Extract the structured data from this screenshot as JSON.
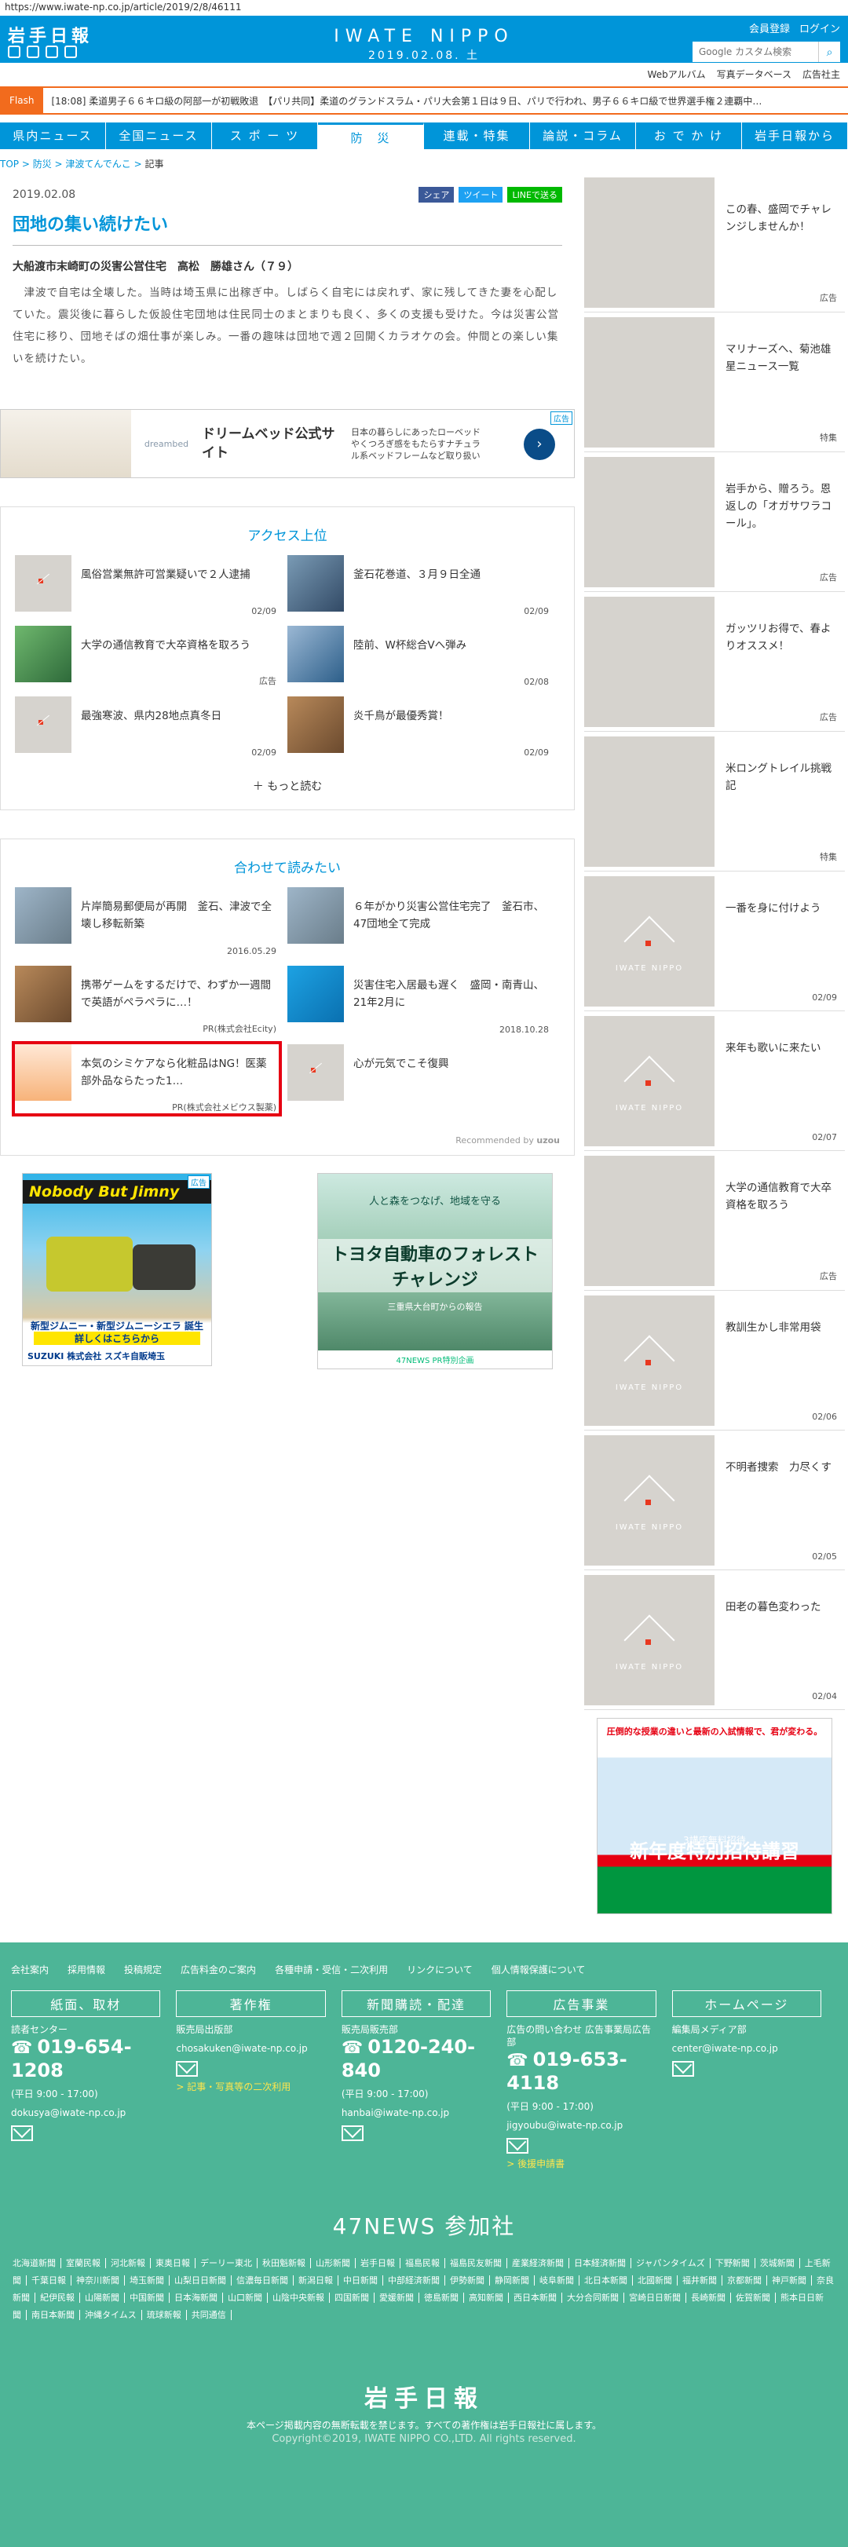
{
  "url": "https://www.iwate-np.co.jp/article/2019/2/8/46111",
  "header": {
    "logo": "岩手日報",
    "brand": "IWATE NIPPO",
    "date": "2019.02.08. 土",
    "member": "会員登録",
    "login": "ログイン",
    "search_placeholder": "Google カスタム検索",
    "sub": [
      "Webアルバム",
      "写真データベース",
      "広告社主"
    ]
  },
  "flash": {
    "label": "Flash",
    "text": "[18:08] 柔道男子６６キロ級の阿部一が初戦敗退　【パリ共同】柔道のグランドスラム・パリ大会第１日は９日、パリで行われ、男子６６キロ級で世界選手権２連覇中…"
  },
  "nav": [
    "県内ニュース",
    "全国ニュース",
    "ス ポ ー ツ",
    "防　災",
    "連載・特集",
    "論説・コラム",
    "お で か け",
    "岩手日報から"
  ],
  "crumb": [
    "TOP",
    "防災",
    "津波てんでんこ",
    "記事"
  ],
  "article": {
    "date": "2019.02.08",
    "share": [
      "シェア",
      "ツイート",
      "LINEで送る"
    ],
    "title": "団地の集い続けたい",
    "name": "大船渡市末崎町の災害公営住宅　高松　勝雄さん（７９）",
    "body": "　津波で自宅は全壊した。当時は埼玉県に出稼ぎ中。しばらく自宅には戻れず、家に残してきた妻を心配していた。震災後に暮らした仮設住宅団地は住民同士のまとまりも良く、多くの支援も受けた。今は災害公営住宅に移り、団地そばの畑仕事が楽しみ。一番の趣味は団地で週２回開くカラオケの会。仲間との楽しい集いを続けたい。"
  },
  "ad1": {
    "brand": "dreambed",
    "head": "ドリームベッド公式サイト",
    "desc": "日本の暮らしにあったローベッドやくつろぎ感をもたらすナチュラル系ベッドフレームなど取り扱い",
    "tag": "広告"
  },
  "access": {
    "title": "アクセス上位",
    "items": [
      {
        "t": "風俗営業無許可営業疑いで２人逮捕",
        "d": "02/09"
      },
      {
        "t": "釜石花巻道、３月９日全通",
        "d": "02/09"
      },
      {
        "t": "大学の通信教育で大卒資格を取ろう",
        "d": "広告"
      },
      {
        "t": "陸前、W杯総合Vへ弾み",
        "d": "02/08"
      },
      {
        "t": "最強寒波、県内28地点真冬日",
        "d": "02/09"
      },
      {
        "t": "炎千鳥が最優秀賞！",
        "d": "02/09"
      }
    ],
    "more": "もっと読む"
  },
  "related": {
    "title": "合わせて読みたい",
    "items": [
      {
        "t": "片岸簡易郵便局が再開　釜石、津波で全壊し移転新築",
        "d": "2016.05.29"
      },
      {
        "t": "６年がかり災害公営住宅完了　釜石市、47団地全て完成",
        "d": ""
      },
      {
        "t": "携帯ゲームをするだけで、わずか一週間で英語がペラペラに…！",
        "d": "PR(株式会社Ecity)"
      },
      {
        "t": "災害住宅入居最も遅く　盛岡・南青山、21年2月に",
        "d": "2018.10.28"
      },
      {
        "t": "本気のシミケアなら化粧品はNG！医薬部外品ならたった1…",
        "d": "PR(株式会社メビウス製薬)"
      },
      {
        "t": "心が元気でこそ復興",
        "d": ""
      }
    ],
    "rec": "Recommended by"
  },
  "ads2": {
    "jimny_title": "Nobody But Jimny",
    "jimny_sub": "新型ジムニー・新型ジムニーシエラ 誕生",
    "jimny_btn": "詳しくはこちらから",
    "jimny_dealer": "SUZUKI 株式会社 スズキ自販埼玉",
    "toyota_copy": "人と森をつなげ、地域を守る",
    "toyota_title": "トヨタ自動車のフォレストチャレンジ",
    "toyota_sub": "三重県大台町からの報告",
    "toyota_foot": "47NEWS PR特別企画",
    "tag": "広告"
  },
  "side": [
    {
      "t": "この春、盛岡でチャレンジしませんか！",
      "d": "広告"
    },
    {
      "t": "マリナーズへ、菊池雄星ニュース一覧",
      "d": "特集"
    },
    {
      "t": "岩手から、贈ろう。恩返しの「オガサワラコール」。",
      "d": "広告"
    },
    {
      "t": "ガッツリお得で、春よりオススメ！",
      "d": "広告"
    },
    {
      "t": "米ロングトレイル挑戦記",
      "d": "特集"
    },
    {
      "t": "一番を身に付けよう",
      "d": "02/09"
    },
    {
      "t": "来年も歌いに来たい",
      "d": "02/07"
    },
    {
      "t": "大学の通信教育で大卒資格を取ろう",
      "d": "広告"
    },
    {
      "t": "教訓生かし非常用袋",
      "d": "02/06"
    },
    {
      "t": "不明者捜索　力尽くす",
      "d": "02/05"
    },
    {
      "t": "田老の暮色変わった",
      "d": "02/04"
    }
  ],
  "sidead": {
    "top": "圧倒的な授業の違いと最新の入試情報で、君が変わる。",
    "mid": "新年度特別招待講習",
    "sub": "3講座無料招待"
  },
  "footer": {
    "links": [
      "会社案内",
      "採用情報",
      "投稿規定",
      "広告料金のご案内",
      "各種申請・受信・二次利用",
      "リンクについて",
      "個人情報保護について"
    ],
    "cols": [
      {
        "h": "紙面、取材",
        "s": "読者センター",
        "tel": "019-654-1208",
        "s2": "(平日 9:00 - 17:00)",
        "m": "dokusya@iwate-np.co.jp",
        "y": ""
      },
      {
        "h": "著作権",
        "s": "販売局出版部",
        "tel": "",
        "s2": "",
        "m": "chosakuken@iwate-np.co.jp",
        "y": "> 記事・写真等の二次利用"
      },
      {
        "h": "新聞購読・配達",
        "s": "販売局販売部",
        "tel": "0120-240-840",
        "s2": "(平日 9:00 - 17:00)",
        "m": "hanbai@iwate-np.co.jp",
        "y": ""
      },
      {
        "h": "広告事業",
        "s": "広告の問い合わせ 広告事業局広告部",
        "tel": "019-653-4118",
        "s2": "(平日 9:00 - 17:00)",
        "m": "jigyoubu@iwate-np.co.jp",
        "y": "> 後援申請書"
      },
      {
        "h": "ホームページ",
        "s": "編集局メディア部",
        "tel": "",
        "s2": "",
        "m": "center@iwate-np.co.jp",
        "y": ""
      }
    ],
    "n47": "47NEWS 参加社",
    "papers": [
      "北海道新聞",
      "室蘭民報",
      "河北新報",
      "東奥日報",
      "デーリー東北",
      "秋田魁新報",
      "山形新聞",
      "岩手日報",
      "福島民報",
      "福島民友新聞",
      "産業経済新聞",
      "日本経済新聞",
      "ジャパンタイムズ",
      "下野新聞",
      "茨城新聞",
      "上毛新聞",
      "千葉日報",
      "神奈川新聞",
      "埼玉新聞",
      "山梨日日新聞",
      "信濃毎日新聞",
      "新潟日報",
      "中日新聞",
      "中部経済新聞",
      "伊勢新聞",
      "静岡新聞",
      "岐阜新聞",
      "北日本新聞",
      "北國新聞",
      "福井新聞",
      "京都新聞",
      "神戸新聞",
      "奈良新聞",
      "紀伊民報",
      "山陽新聞",
      "中国新聞",
      "日本海新聞",
      "山口新聞",
      "山陰中央新報",
      "四国新聞",
      "愛媛新聞",
      "徳島新聞",
      "高知新聞",
      "西日本新聞",
      "大分合同新聞",
      "宮崎日日新聞",
      "長崎新聞",
      "佐賀新聞",
      "熊本日日新聞",
      "南日本新聞",
      "沖縄タイムス",
      "琉球新報",
      "共同通信"
    ],
    "logo": "岩手日報",
    "note": "本ページ掲載内容の無断転載を禁じます。すべての著作権は岩手日報社に属します。",
    "copy": "Copyright©2019, IWATE NIPPO CO.,LTD. All rights reserved."
  }
}
